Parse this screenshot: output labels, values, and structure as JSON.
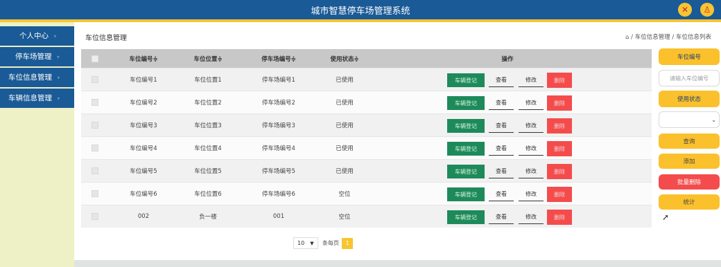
{
  "app": {
    "title": "城市智慧停车场管理系统",
    "icon_close": "✕",
    "icon_user": "♙"
  },
  "sidebar": {
    "items": [
      {
        "label": "个人中心"
      },
      {
        "label": "停车场管理"
      },
      {
        "label": "车位信息管理"
      },
      {
        "label": "车辆信息管理"
      }
    ]
  },
  "page": {
    "title": "车位信息管理",
    "breadcrumb": "⌂ / 车位信息管理 / 车位信息列表"
  },
  "table": {
    "headers": [
      "车位编号≑",
      "车位位置≑",
      "停车场编号≑",
      "使用状态≑",
      "操作"
    ],
    "action_labels": {
      "register": "车辆登记",
      "view": "查看",
      "edit": "修改",
      "delete": "删除"
    },
    "rows": [
      {
        "code": "车位编号1",
        "location": "车位位置1",
        "lot": "停车场编号1",
        "status": "已使用"
      },
      {
        "code": "车位编号2",
        "location": "车位位置2",
        "lot": "停车场编号2",
        "status": "已使用"
      },
      {
        "code": "车位编号3",
        "location": "车位位置3",
        "lot": "停车场编号3",
        "status": "已使用"
      },
      {
        "code": "车位编号4",
        "location": "车位位置4",
        "lot": "停车场编号4",
        "status": "已使用"
      },
      {
        "code": "车位编号5",
        "location": "车位位置5",
        "lot": "停车场编号5",
        "status": "已使用"
      },
      {
        "code": "车位编号6",
        "location": "车位位置6",
        "lot": "停车场编号6",
        "status": "空位"
      },
      {
        "code": "002",
        "location": "负一楼",
        "lot": "001",
        "status": "空位"
      }
    ]
  },
  "pagination": {
    "page_size": "10",
    "per_page_label": "条每页",
    "current_page": "1"
  },
  "filters": {
    "code_label": "车位编号",
    "code_placeholder": "请输入车位编号",
    "status_label": "使用状态",
    "status_value": "",
    "search": "查询",
    "add": "添加",
    "batch_delete": "批量删除",
    "stats": "统计"
  },
  "colors": {
    "primary": "#1a5a96",
    "accent": "#f7c531",
    "success": "#1e8a5a",
    "danger": "#f44c4c",
    "sidebar_bg": "#eef0c6"
  }
}
